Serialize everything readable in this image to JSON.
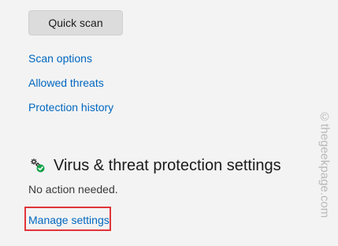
{
  "actions": {
    "quick_scan_label": "Quick scan"
  },
  "links": {
    "scan_options": "Scan options",
    "allowed_threats": "Allowed threats",
    "protection_history": "Protection history"
  },
  "virus_settings": {
    "icon": "gear-shield-check-icon",
    "title": "Virus & threat protection settings",
    "status": "No action needed.",
    "manage_link": "Manage settings"
  },
  "watermark": "©thegeekpage.com",
  "colors": {
    "link": "#0067c0",
    "highlight": "#e0353a",
    "status_ok": "#16a34a",
    "background": "#f3f3f3"
  }
}
